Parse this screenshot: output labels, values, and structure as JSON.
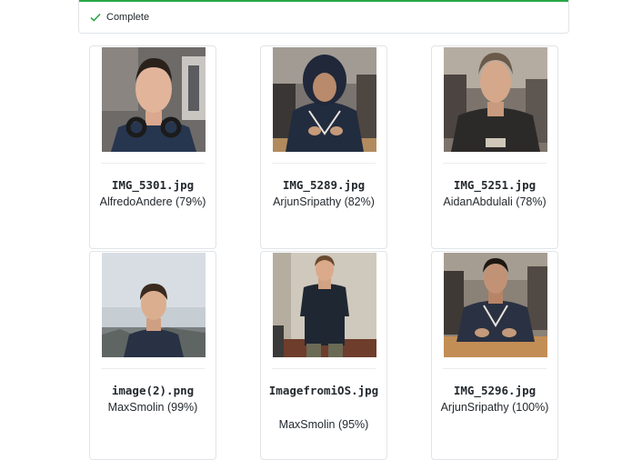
{
  "status": {
    "label": "Complete",
    "accent": "#28a745"
  },
  "results": [
    {
      "filename": "IMG_5301.jpg",
      "prediction": "AlfredoAndere (79%)"
    },
    {
      "filename": "IMG_5289.jpg",
      "prediction": "ArjunSripathy (82%)"
    },
    {
      "filename": "IMG_5251.jpg",
      "prediction": "AidanAbdulali (78%)"
    },
    {
      "filename": "image(2).png",
      "prediction": "MaxSmolin (99%)"
    },
    {
      "filename": "ImagefromiOS.jpg",
      "prediction": "MaxSmolin (95%)"
    },
    {
      "filename": "IMG_5296.jpg",
      "prediction": "ArjunSripathy (100%)"
    }
  ]
}
